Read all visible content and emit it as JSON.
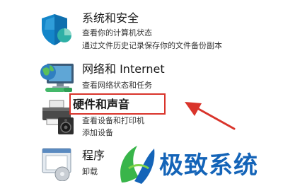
{
  "categories": [
    {
      "title": "系统和安全",
      "icon": "shield-icon",
      "links": [
        "查看你的计算机状态",
        "通过文件历史记录保存你的文件备份副本"
      ]
    },
    {
      "title": "网络和 Internet",
      "icon": "network-globe-icon",
      "links": [
        "查看网络状态和任务"
      ]
    },
    {
      "title": "硬件和声音",
      "icon": "printer-speaker-icon",
      "links": [
        "查看设备和打印机",
        "添加设备"
      ]
    },
    {
      "title": "程序",
      "icon": "programs-icon",
      "links": [
        "卸载"
      ]
    }
  ],
  "annotation": {
    "highlight_color": "#d9342b",
    "arrow_color": "#d9342b"
  },
  "watermark": {
    "text": "极致系统",
    "color": "#1464b8"
  }
}
